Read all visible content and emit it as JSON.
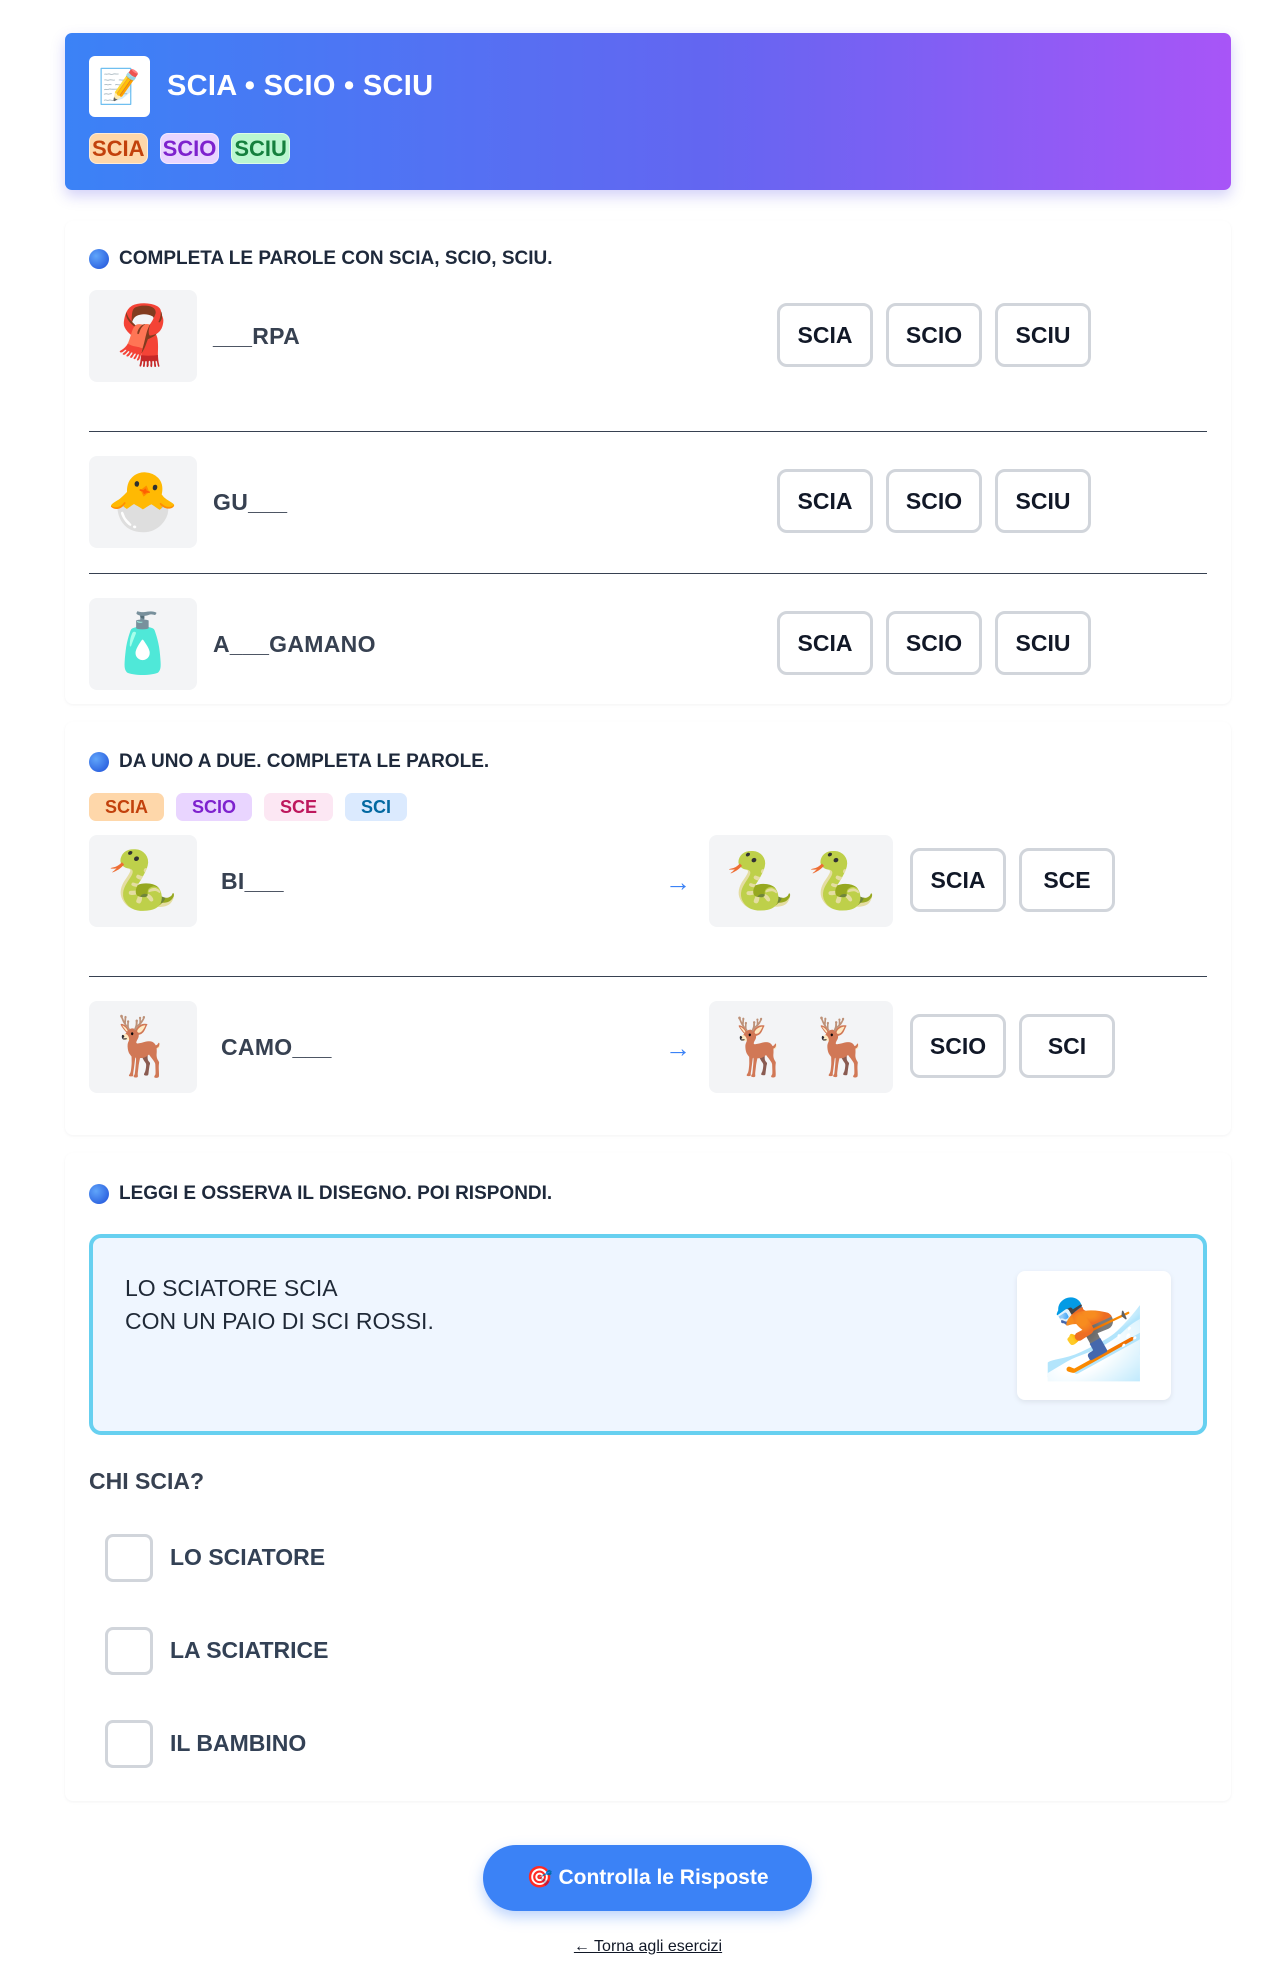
{
  "header": {
    "logo_icon": "📝",
    "title": "SCIA • SCIO • SCIU",
    "chips": [
      "SCIA",
      "SCIO",
      "SCIU"
    ]
  },
  "exercise1": {
    "title": "COMPLETA LE PAROLE CON SCIA, SCIO, SCIU.",
    "options": [
      "SCIA",
      "SCIO",
      "SCIU"
    ],
    "items": [
      {
        "icon": "🧣",
        "word": "___RPA"
      },
      {
        "icon": "🐣",
        "word": "GU___"
      },
      {
        "icon": "🧴",
        "word": "A___GAMANO"
      }
    ]
  },
  "exercise2": {
    "title": "DA UNO A DUE. COMPLETA LE PAROLE.",
    "legend": [
      "SCIA",
      "SCIO",
      "SCE",
      "SCI"
    ],
    "arrow": "→",
    "items": [
      {
        "icon": "🐍",
        "word": "BI___",
        "pair_icons": [
          "🐍",
          "🐍"
        ],
        "options": [
          "SCIA",
          "SCE"
        ]
      },
      {
        "icon": "🦌",
        "word": "CAMO___",
        "pair_icons": [
          "🦌",
          "🦌"
        ],
        "options": [
          "SCIO",
          "SCI"
        ]
      }
    ]
  },
  "exercise3": {
    "title": "LEGGI E OSSERVA IL DISEGNO. POI RISPONDI.",
    "text_line1": "LO SCIATORE SCIA",
    "text_line2": "CON UN PAIO DI SCI ROSSI.",
    "picture_icon": "⛷️",
    "question": "CHI SCIA?",
    "answers": [
      "LO SCIATORE",
      "LA SCIATRICE",
      "IL BAMBINO"
    ]
  },
  "footer": {
    "check_button": "🎯 Controlla le Risposte",
    "back_link": "← Torna agli esercizi"
  }
}
